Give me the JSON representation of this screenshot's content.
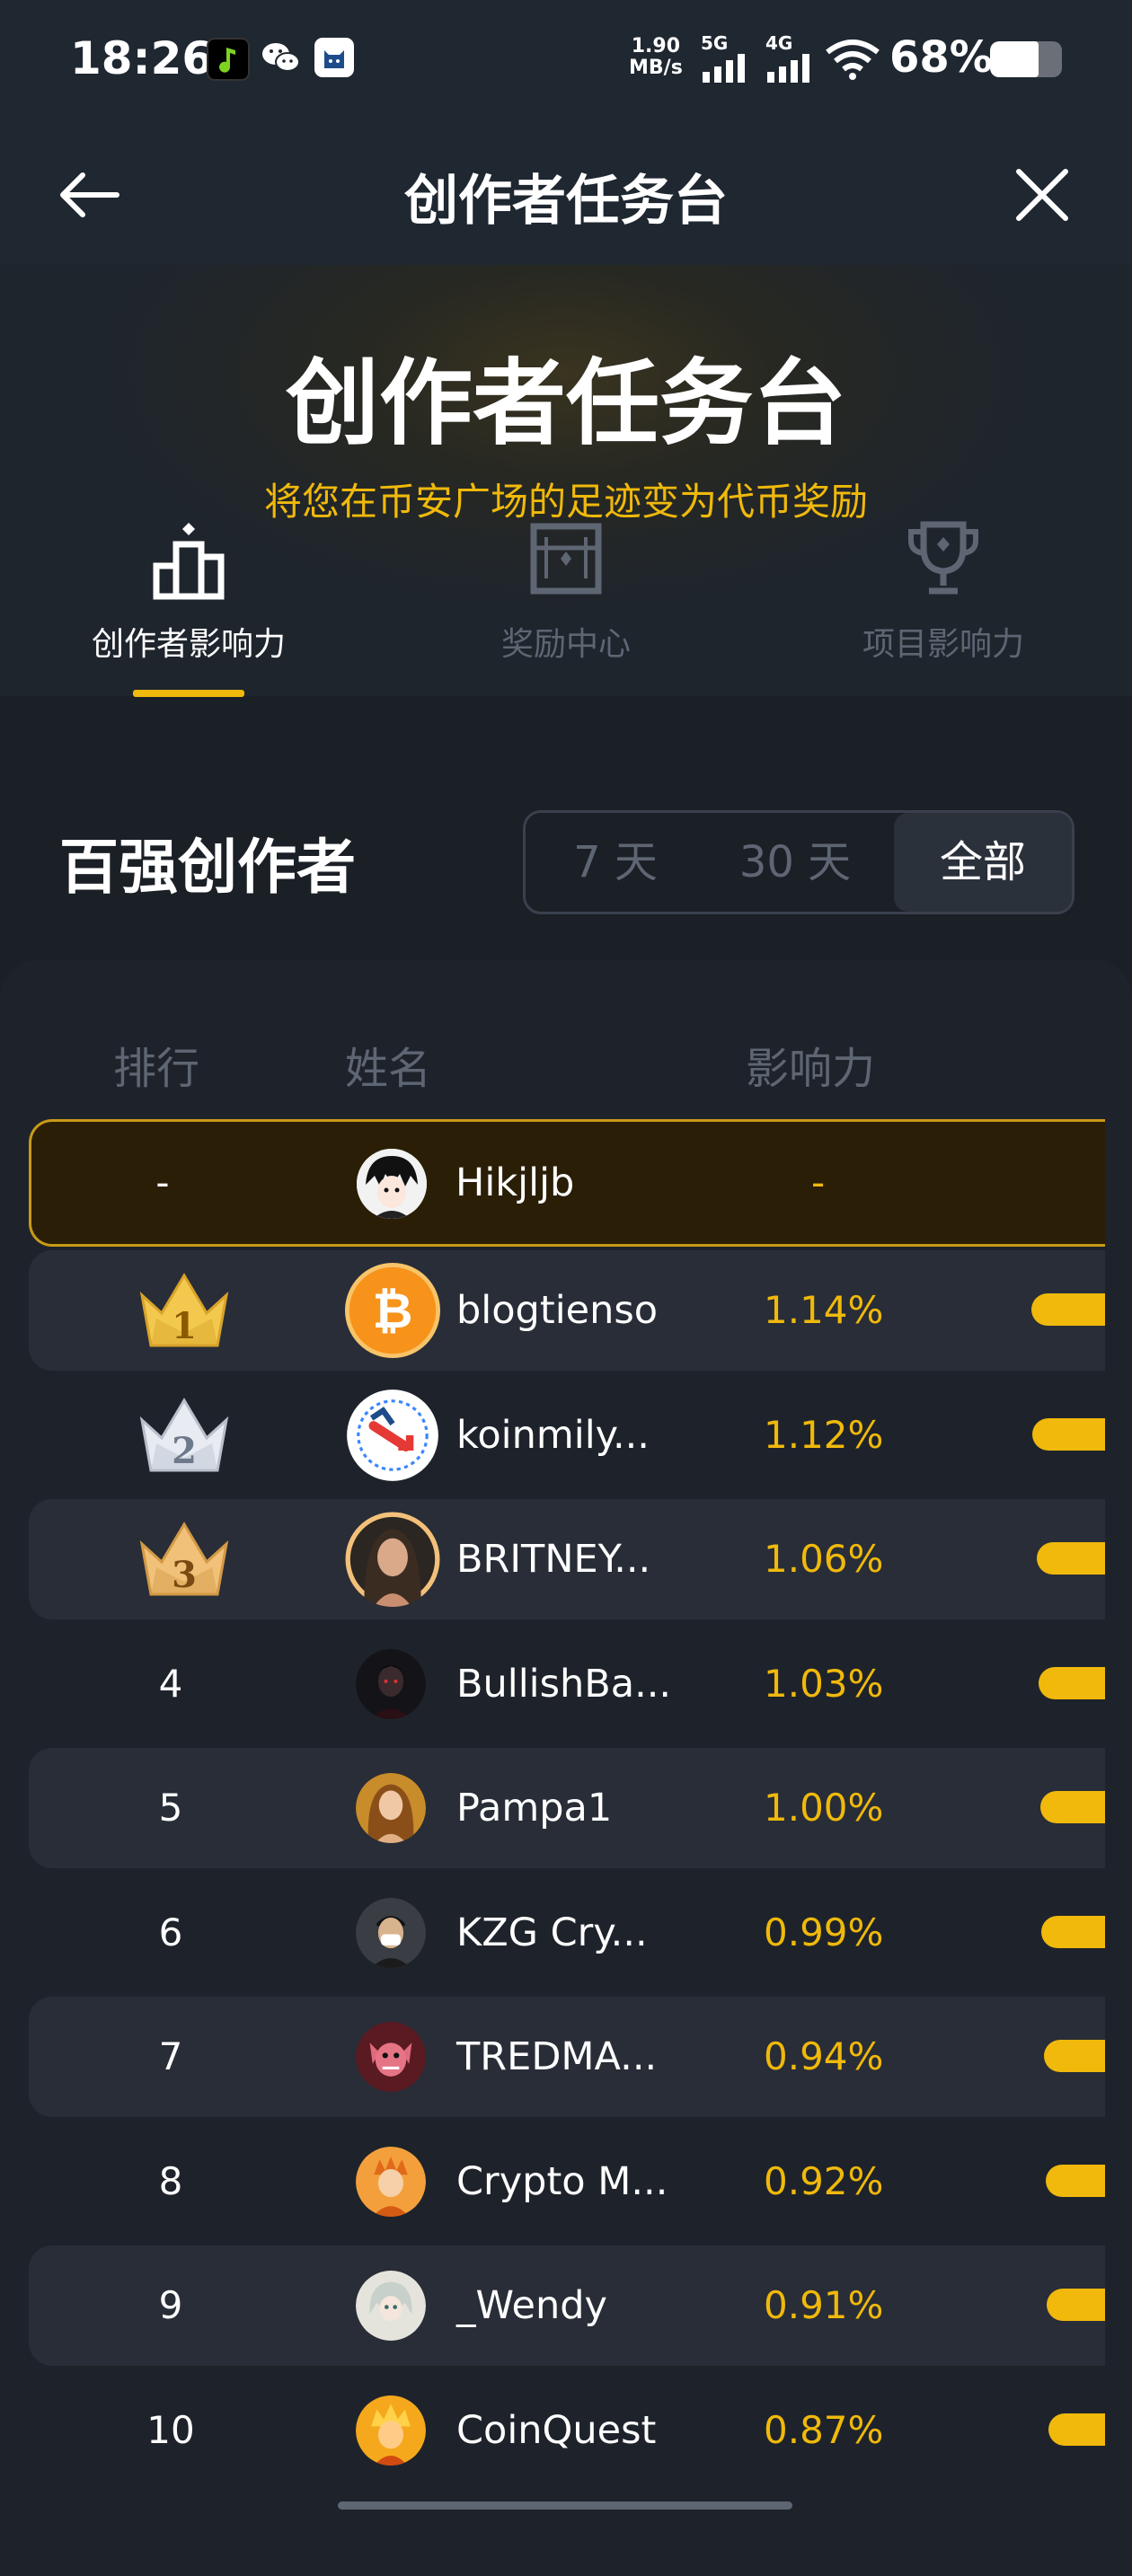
{
  "status_bar": {
    "time": "18:26",
    "speed_value": "1.90",
    "speed_unit": "MB/s",
    "net1": "5G",
    "net2": "4G",
    "battery_text": "68%",
    "battery_level": 0.68
  },
  "nav": {
    "title": "创作者任务台",
    "back_icon": "arrow-left-icon",
    "close_icon": "close-icon"
  },
  "hero": {
    "headline": "创作者任务台",
    "subtitle": "将您在币安广场的足迹变为代币奖励"
  },
  "tabs": [
    {
      "label": "创作者影响力",
      "icon": "podium-icon",
      "active": true
    },
    {
      "label": "奖励中心",
      "icon": "ticket-icon",
      "active": false
    },
    {
      "label": "项目影响力",
      "icon": "trophy-icon",
      "active": false
    }
  ],
  "leaderboard": {
    "title": "百强创作者",
    "periods": [
      "7 天",
      "30 天",
      "全部"
    ],
    "selected_period": "全部",
    "columns": [
      "排行",
      "姓名",
      "影响力"
    ],
    "me": {
      "rank": "-",
      "name": "Hikjljb",
      "influence": "-"
    },
    "rows": [
      {
        "rank": "1",
        "name": "blogtienso",
        "influence": "1.14%",
        "value": 1.14
      },
      {
        "rank": "2",
        "name": "koinmily...",
        "influence": "1.12%",
        "value": 1.12
      },
      {
        "rank": "3",
        "name": "BRITNEY...",
        "influence": "1.06%",
        "value": 1.06
      },
      {
        "rank": "4",
        "name": "BullishBa...",
        "influence": "1.03%",
        "value": 1.03
      },
      {
        "rank": "5",
        "name": "Pampa1",
        "influence": "1.00%",
        "value": 1.0
      },
      {
        "rank": "6",
        "name": "KZG Cry...",
        "influence": "0.99%",
        "value": 0.99
      },
      {
        "rank": "7",
        "name": "TREDMA...",
        "influence": "0.94%",
        "value": 0.94
      },
      {
        "rank": "8",
        "name": "Crypto M...",
        "influence": "0.92%",
        "value": 0.92
      },
      {
        "rank": "9",
        "name": "_Wendy",
        "influence": "0.91%",
        "value": 0.91
      },
      {
        "rank": "10",
        "name": "CoinQuest",
        "influence": "0.87%",
        "value": 0.87
      }
    ]
  },
  "colors": {
    "accent": "#f0b90b",
    "background": "#1b1f26",
    "panel": "#1e232b",
    "row_alt": "#282d37",
    "muted": "#5e6673"
  }
}
